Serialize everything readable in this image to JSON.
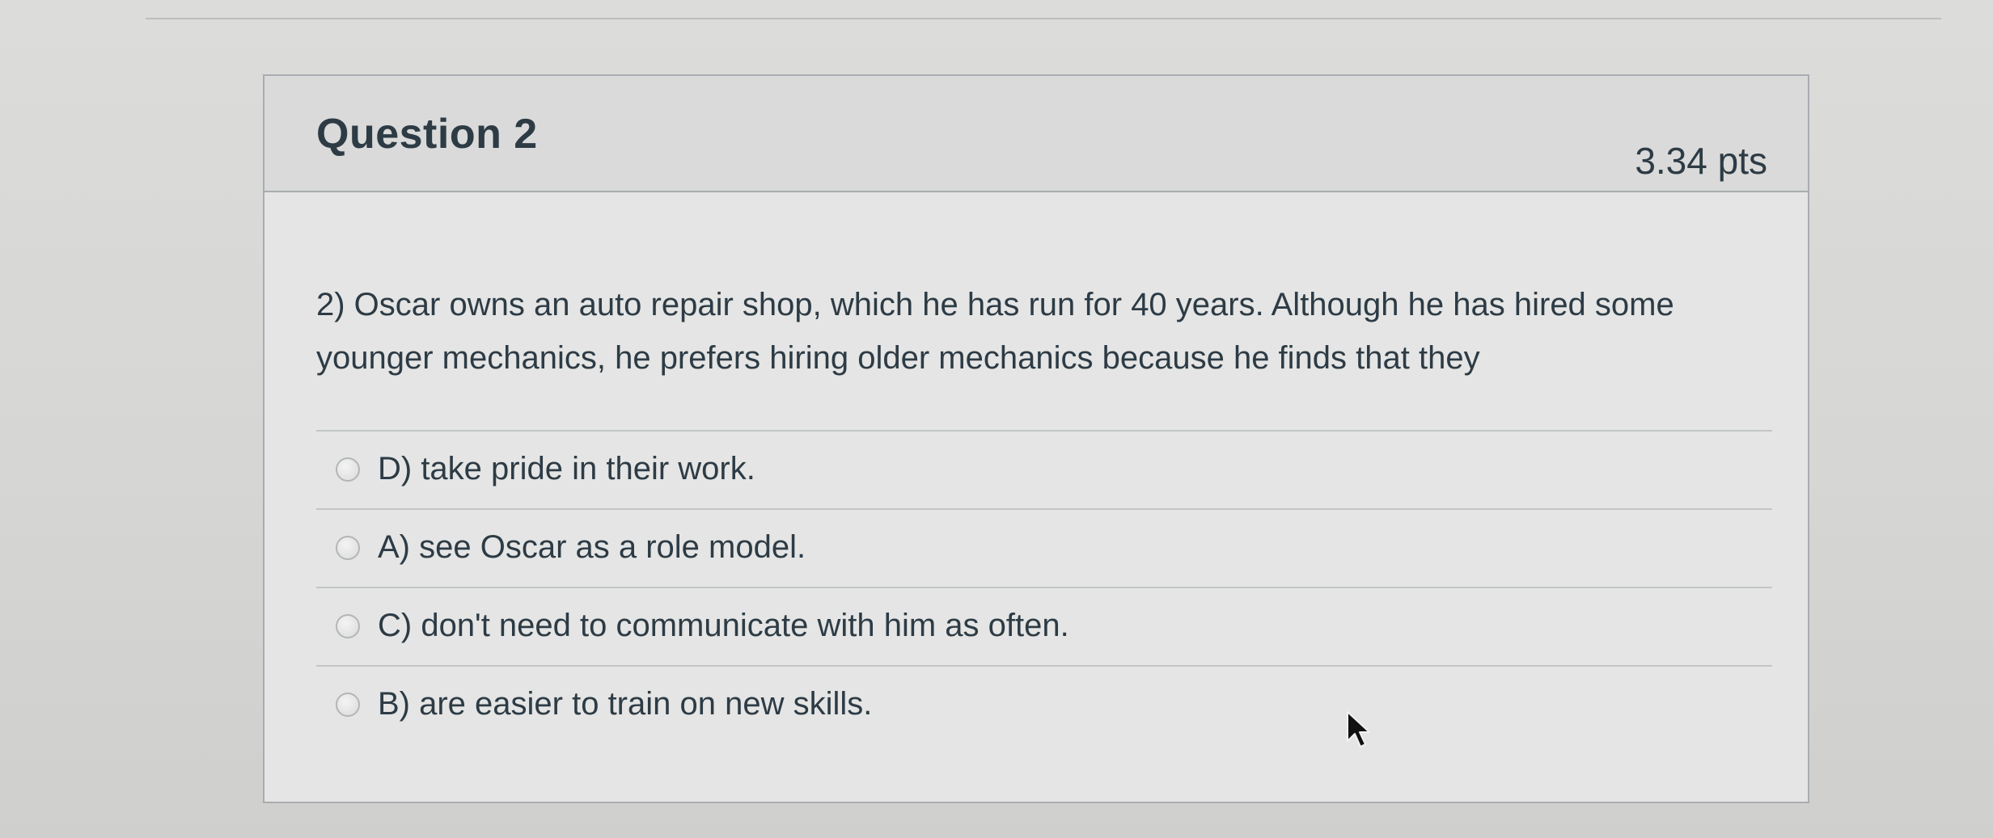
{
  "question": {
    "title": "Question 2",
    "points": "3.34 pts",
    "text": "2) Oscar owns an auto repair shop, which he has run for 40 years. Although he has hired some younger mechanics, he prefers hiring older mechanics because he finds that they",
    "answers": [
      {
        "label": "D) take pride in their work.",
        "selected": false
      },
      {
        "label": "A) see Oscar as a role model.",
        "selected": false
      },
      {
        "label": "C) don't need to communicate with him as often.",
        "selected": false
      },
      {
        "label": "B) are easier to train on new skills.",
        "selected": false
      }
    ]
  },
  "icons": {
    "radio": "radio-button-icon",
    "cursor": "mouse-pointer-icon"
  },
  "colors": {
    "text": "#2d3b45",
    "header_background": "#d9dad9",
    "card_border": "#a9adb1"
  }
}
